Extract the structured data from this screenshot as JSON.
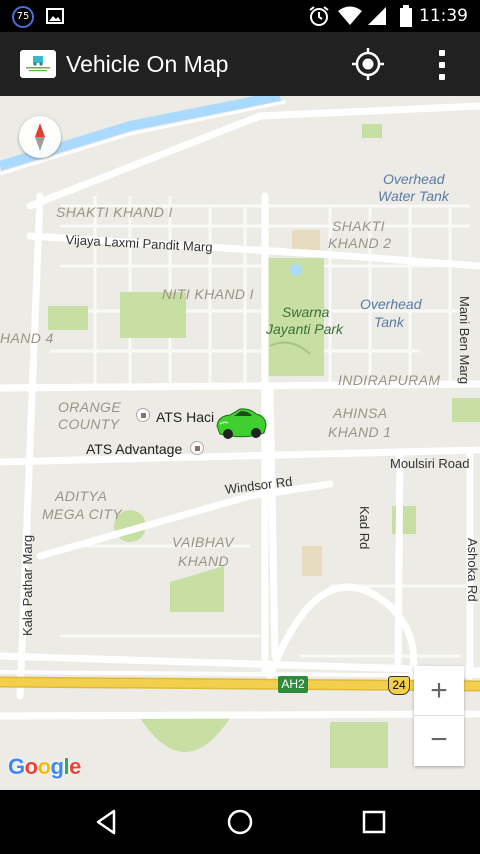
{
  "status_bar": {
    "badge": "75",
    "time": "11:39",
    "icons": [
      "image-icon",
      "alarm-icon",
      "wifi-icon",
      "signal-icon",
      "battery-icon"
    ]
  },
  "app_bar": {
    "title": "Vehicle On Map",
    "logo": "tracking-logo",
    "actions": [
      "my-location-icon",
      "more-vert-icon"
    ]
  },
  "map": {
    "areas": {
      "shakti_khand_1": "SHAKTI KHAND I",
      "shakti_khand_2_line1": "SHAKTI",
      "shakti_khand_2_line2": "KHAND 2",
      "niti_khand": "NITI KHAND I",
      "khand_4": "HAND 4",
      "indirapuram": "INDIRAPURAM",
      "orange_county_line1": "ORANGE",
      "orange_county_line2": "COUNTY",
      "ahinsa_line1": "AHINSA",
      "ahinsa_line2": "KHAND 1",
      "aditya_line1": "ADITYA",
      "aditya_line2": "MEGA CITY",
      "vaibhav_line1": "VAIBHAV",
      "vaibhav_line2": "KHAND"
    },
    "parks": {
      "swarna_line1": "Swarna",
      "swarna_line2": "Jayanti Park"
    },
    "water": {
      "tank1_line1": "Overhead",
      "tank1_line2": "Water Tank",
      "tank2_line1": "Overhead",
      "tank2_line2": "Tank"
    },
    "roads": {
      "vijaya": "Vijaya Laxmi Pandit Marg",
      "windsor": "Windsor Rd",
      "moulsiri": "Moulsiri Road",
      "kad": "Kad Rd",
      "mani_ben": "Mani Ben Marg",
      "ashoka": "Ashoka Rd",
      "kala_pathar": "Kala Pathar Marg",
      "ah2": "AH2",
      "route_24": "24"
    },
    "pois": {
      "ats_haciend": "ATS Haci",
      "ats_advantage": "ATS Advantage"
    },
    "vehicle_marker": "car-icon",
    "zoom_in": "+",
    "zoom_out": "−",
    "attribution": [
      "G",
      "o",
      "o",
      "g",
      "l",
      "e"
    ]
  },
  "colors": {
    "app_bar": "#212121",
    "map_bg": "#ecebe6",
    "park": "#c8dfa4",
    "water": "#aadaff",
    "highway": "#f3d04b",
    "vehicle": "#3fcf2f"
  },
  "nav_bar": {
    "buttons": [
      "back-icon",
      "home-icon",
      "recents-icon"
    ]
  }
}
